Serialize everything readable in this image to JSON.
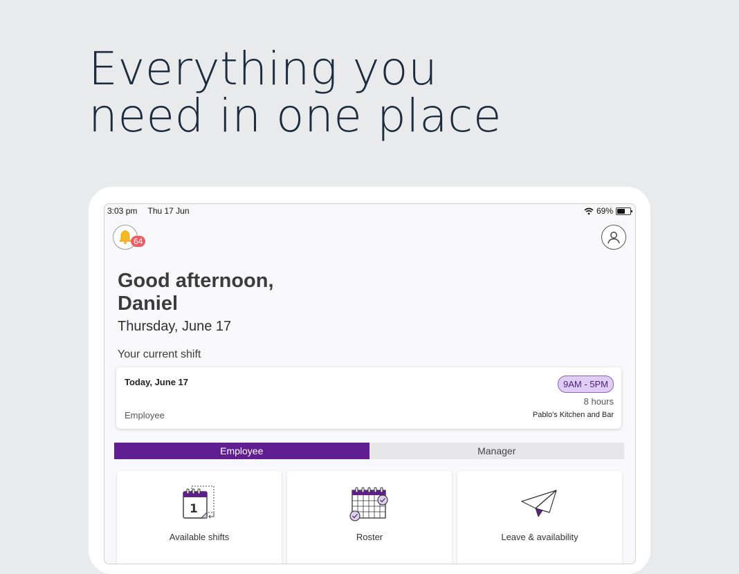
{
  "headline": {
    "line1": "Everything you",
    "line2": "need in one place"
  },
  "status_bar": {
    "time": "3:03 pm",
    "date": "Thu 17 Jun",
    "battery_percent": "69%",
    "battery_level": 0.69
  },
  "notifications": {
    "count": "64"
  },
  "greeting": {
    "line1": "Good afternoon,",
    "line2": "Daniel",
    "date": "Thursday, June 17"
  },
  "current_shift": {
    "section_label": "Your current shift",
    "date": "Today, June 17",
    "role": "Employee",
    "time": "9AM - 5PM",
    "hours": "8 hours",
    "location": "Pablo's Kitchen and Bar"
  },
  "mode_tabs": [
    {
      "label": "Employee",
      "active": true
    },
    {
      "label": "Manager",
      "active": false
    }
  ],
  "tiles": [
    {
      "label": "Available shifts",
      "icon": "calendar-day-icon"
    },
    {
      "label": "Roster",
      "icon": "roster-calendar-icon"
    },
    {
      "label": "Leave & availability",
      "icon": "paper-plane-icon"
    }
  ],
  "colors": {
    "accent": "#611e90",
    "badge": "#ef5b63",
    "shift_pill": "#e0cdf3"
  }
}
